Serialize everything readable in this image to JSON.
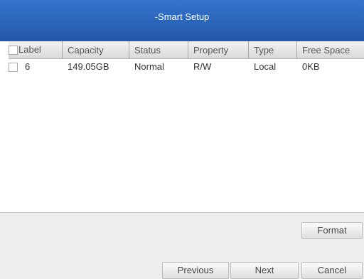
{
  "window": {
    "title": "-Smart Setup"
  },
  "table": {
    "headers": [
      "Label",
      "Capacity",
      "Status",
      "Property",
      "Type",
      "Free Space"
    ],
    "rows": [
      {
        "label": "6",
        "capacity": "149.05GB",
        "status": "Normal",
        "property": "R/W",
        "type": "Local",
        "free_space": "0KB"
      }
    ]
  },
  "buttons": {
    "format": "Format",
    "previous": "Previous",
    "next": "Next",
    "cancel": "Cancel"
  }
}
